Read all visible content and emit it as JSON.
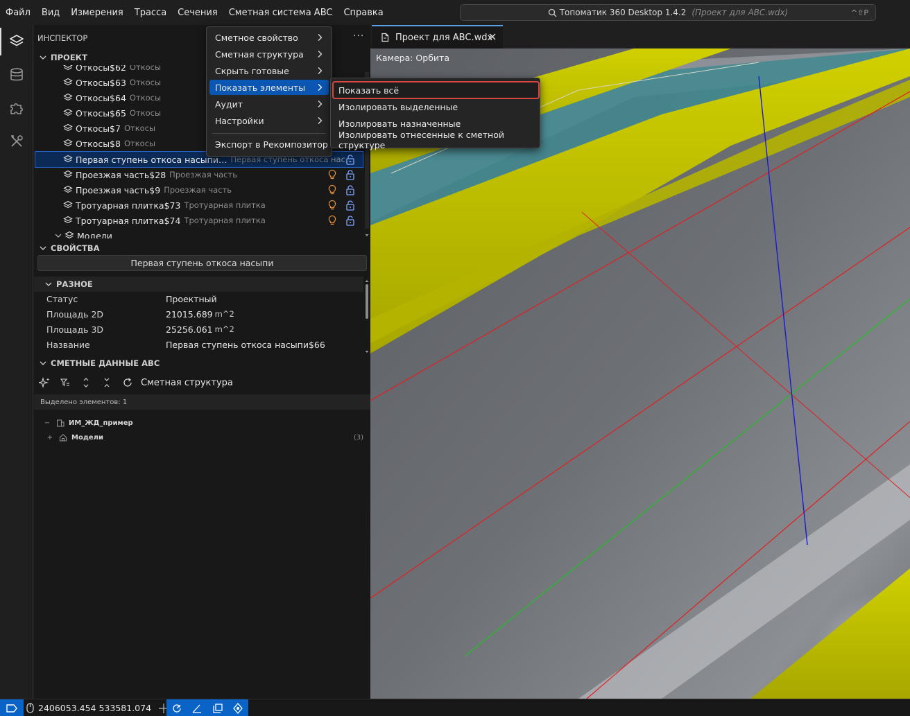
{
  "menubar": {
    "items": [
      "Файл",
      "Вид",
      "Измерения",
      "Трасса",
      "Сечения",
      "Сметная система ABC",
      "Справка"
    ],
    "search": {
      "app": "Топоматик 360 Desktop 1.4.2",
      "project": "(Проект для ABC.wdx)",
      "shortcut": "^⇧P"
    }
  },
  "activity_bar": [
    "layers-icon",
    "database-icon",
    "puzzle-icon",
    "tools-icon"
  ],
  "inspector": {
    "title": "ИНСПЕКТОР",
    "more": "···",
    "project_section": "ПРОЕКТ",
    "tree": [
      {
        "name": "Откосы$62",
        "type": "Откосы"
      },
      {
        "name": "Откосы$63",
        "type": "Откосы"
      },
      {
        "name": "Откосы$64",
        "type": "Откосы"
      },
      {
        "name": "Откосы$65",
        "type": "Откосы"
      },
      {
        "name": "Откосы$7",
        "type": "Откосы"
      },
      {
        "name": "Откосы$8",
        "type": "Откосы"
      },
      {
        "name": "Первая ступень откоса насыпи…",
        "type": "Первая ступень откоса нас…"
      },
      {
        "name": "Проезжая часть$28",
        "type": "Проезжая часть"
      },
      {
        "name": "Проезжая часть$9",
        "type": "Проезжая часть"
      },
      {
        "name": "Тротуарная плитка$73",
        "type": "Тротуарная плитка"
      },
      {
        "name": "Тротуарная плитка$74",
        "type": "Тротуарная плитка"
      },
      {
        "name": "Модели",
        "type": ""
      }
    ],
    "selected_index": 6
  },
  "properties": {
    "title": "СВОЙСТВА",
    "element_name": "Первая ступень откоса насыпи",
    "group": "РАЗНОЕ",
    "rows": [
      {
        "key": "Статус",
        "value": "Проектный",
        "unit": ""
      },
      {
        "key": "Площадь 2D",
        "value": "21015.689",
        "unit": "m^2"
      },
      {
        "key": "Площадь 3D",
        "value": "25256.061",
        "unit": "m^2"
      },
      {
        "key": "Название",
        "value": "Первая ступень откоса насыпи$66",
        "unit": ""
      }
    ]
  },
  "abc": {
    "title": "СМЕТНЫЕ ДАННЫЕ ABC",
    "toolbar_label": "Сметная структура",
    "selected_count": "Выделено элементов: 1",
    "items": [
      {
        "toggle": "−",
        "name": "ИМ_ЖД_пример",
        "count": ""
      },
      {
        "toggle": "+",
        "name": "Модели",
        "count": "(3)"
      }
    ]
  },
  "editor": {
    "tab_label": "Проект для ABC.wdx",
    "camera_label": "Камера: Орбита"
  },
  "context_menu": {
    "items": [
      "Сметное свойство",
      "Сметная структура",
      "Скрыть готовые",
      "Показать элементы",
      "Аудит",
      "Настройки"
    ],
    "export": "Экспорт в Рекомпозитор",
    "highlighted": "Показать элементы",
    "submenu": [
      "Показать всё",
      "Изолировать выделенные",
      "Изолировать назначенные",
      "Изолировать отнесенные к сметной структуре"
    ]
  },
  "statusbar": {
    "coords": "2406053.454 533581.074"
  },
  "colors": {
    "accent": "#0a64c8",
    "menu_highlight": "#0b56b3",
    "focus_outline": "#d6463f",
    "road_yellow": "#c9c900",
    "teal_band": "#3f8a90",
    "surface_gray": "#6c6f74"
  }
}
